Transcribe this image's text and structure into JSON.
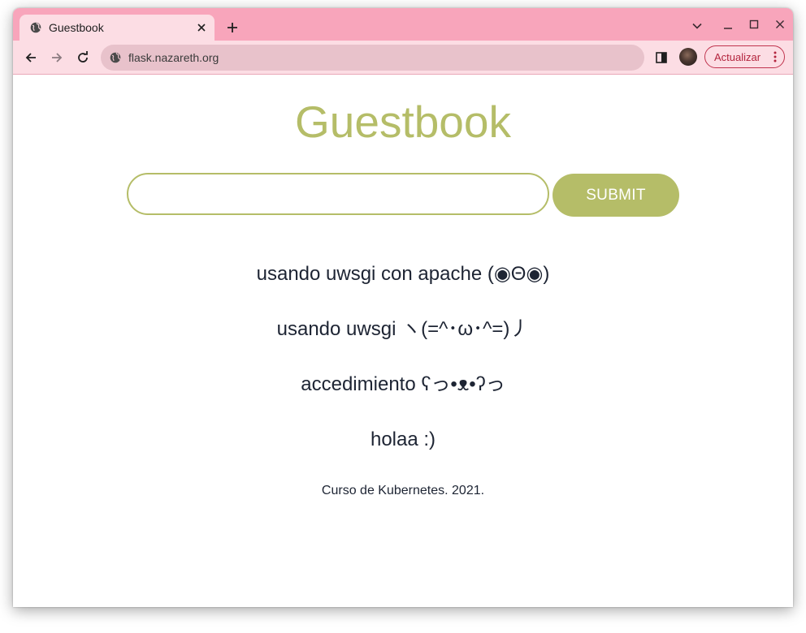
{
  "browser": {
    "tab": {
      "title": "Guestbook",
      "favicon": "globe-icon",
      "close_icon": "close-icon"
    },
    "new_tab_icon": "plus-icon",
    "window_controls": [
      "chevron-down-icon",
      "minimize-icon",
      "maximize-icon",
      "close-icon"
    ],
    "toolbar": {
      "url": "flask.nazareth.org",
      "update_label": "Actualizar"
    },
    "colors": {
      "tabstrip": "#f8a5bb",
      "toolbar": "#fcdde4",
      "omnibox": "#e8c2cb",
      "update_accent": "#c0344e"
    }
  },
  "page": {
    "title": "Guestbook",
    "input": {
      "value": "",
      "placeholder": ""
    },
    "submit_label": "SUBMIT",
    "messages": [
      "usando uwsgi con apache (◉Θ◉)",
      "usando uwsgi ヽ(=^･ω･^=)丿",
      "accedimiento ʕっ•ᴥ•ʔっ",
      "holaa :)"
    ],
    "footer": "Curso de Kubernetes. 2021.",
    "colors": {
      "accent": "#b5bd68",
      "text": "#1d2433"
    }
  }
}
